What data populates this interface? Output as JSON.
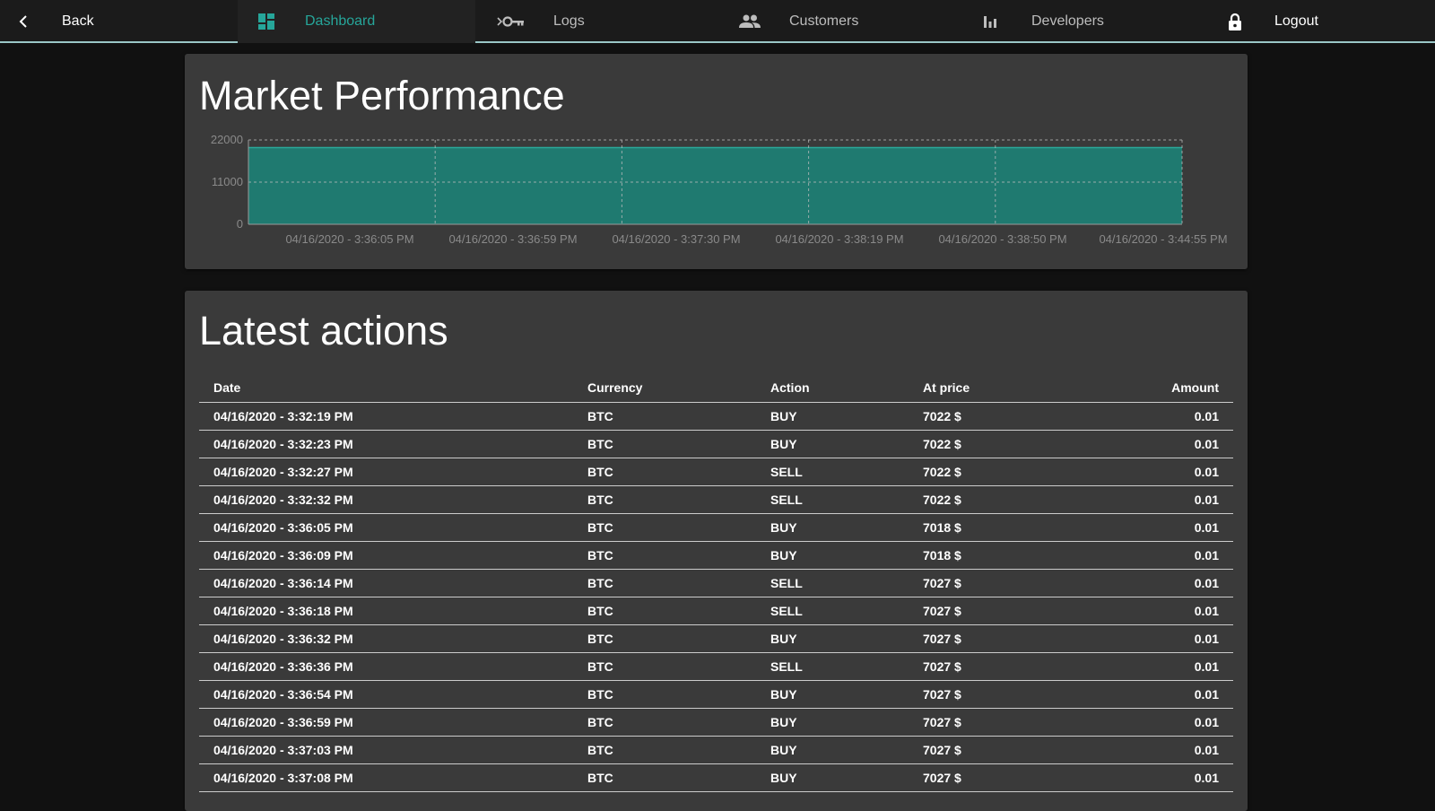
{
  "nav": {
    "back": {
      "label": "Back",
      "icon": "chevron-left-icon"
    },
    "dashboard": {
      "label": "Dashboard",
      "icon": "dashboard-icon"
    },
    "logs": {
      "label": "Logs",
      "icon": "key-icon"
    },
    "customers": {
      "label": "Customers",
      "icon": "people-icon"
    },
    "developers": {
      "label": "Developers",
      "icon": "bar-chart-icon"
    },
    "logout": {
      "label": "Logout",
      "icon": "lock-icon"
    },
    "accent_color": "#26a69a"
  },
  "market": {
    "title": "Market Performance"
  },
  "chart_data": {
    "type": "area",
    "title": "Market Performance",
    "x": [
      "04/16/2020 - 3:36:05 PM",
      "04/16/2020 - 3:36:59 PM",
      "04/16/2020 - 3:37:30 PM",
      "04/16/2020 - 3:38:19 PM",
      "04/16/2020 - 3:38:50 PM",
      "04/16/2020 - 3:44:55 PM"
    ],
    "series": [
      {
        "values": [
          20000,
          20000,
          20000,
          20000,
          20000,
          20000
        ],
        "color": "#1f7a70"
      }
    ],
    "y_ticks": [
      "22000",
      "11000",
      "0"
    ],
    "ylim": [
      0,
      22000
    ],
    "grid": true,
    "xlabel": "",
    "ylabel": ""
  },
  "latest": {
    "title": "Latest actions",
    "columns": [
      "Date",
      "Currency",
      "Action",
      "At price",
      "Amount"
    ],
    "rows": [
      {
        "date": "04/16/2020 - 3:32:19 PM",
        "currency": "BTC",
        "action": "BUY",
        "price": "7022 $",
        "amount": "0.01"
      },
      {
        "date": "04/16/2020 - 3:32:23 PM",
        "currency": "BTC",
        "action": "BUY",
        "price": "7022 $",
        "amount": "0.01"
      },
      {
        "date": "04/16/2020 - 3:32:27 PM",
        "currency": "BTC",
        "action": "SELL",
        "price": "7022 $",
        "amount": "0.01"
      },
      {
        "date": "04/16/2020 - 3:32:32 PM",
        "currency": "BTC",
        "action": "SELL",
        "price": "7022 $",
        "amount": "0.01"
      },
      {
        "date": "04/16/2020 - 3:36:05 PM",
        "currency": "BTC",
        "action": "BUY",
        "price": "7018 $",
        "amount": "0.01"
      },
      {
        "date": "04/16/2020 - 3:36:09 PM",
        "currency": "BTC",
        "action": "BUY",
        "price": "7018 $",
        "amount": "0.01"
      },
      {
        "date": "04/16/2020 - 3:36:14 PM",
        "currency": "BTC",
        "action": "SELL",
        "price": "7027 $",
        "amount": "0.01"
      },
      {
        "date": "04/16/2020 - 3:36:18 PM",
        "currency": "BTC",
        "action": "SELL",
        "price": "7027 $",
        "amount": "0.01"
      },
      {
        "date": "04/16/2020 - 3:36:32 PM",
        "currency": "BTC",
        "action": "BUY",
        "price": "7027 $",
        "amount": "0.01"
      },
      {
        "date": "04/16/2020 - 3:36:36 PM",
        "currency": "BTC",
        "action": "SELL",
        "price": "7027 $",
        "amount": "0.01"
      },
      {
        "date": "04/16/2020 - 3:36:54 PM",
        "currency": "BTC",
        "action": "BUY",
        "price": "7027 $",
        "amount": "0.01"
      },
      {
        "date": "04/16/2020 - 3:36:59 PM",
        "currency": "BTC",
        "action": "BUY",
        "price": "7027 $",
        "amount": "0.01"
      },
      {
        "date": "04/16/2020 - 3:37:03 PM",
        "currency": "BTC",
        "action": "BUY",
        "price": "7027 $",
        "amount": "0.01"
      },
      {
        "date": "04/16/2020 - 3:37:08 PM",
        "currency": "BTC",
        "action": "BUY",
        "price": "7027 $",
        "amount": "0.01"
      }
    ],
    "buy_color": "#1f8b1f",
    "sell_color": "#e01818"
  }
}
